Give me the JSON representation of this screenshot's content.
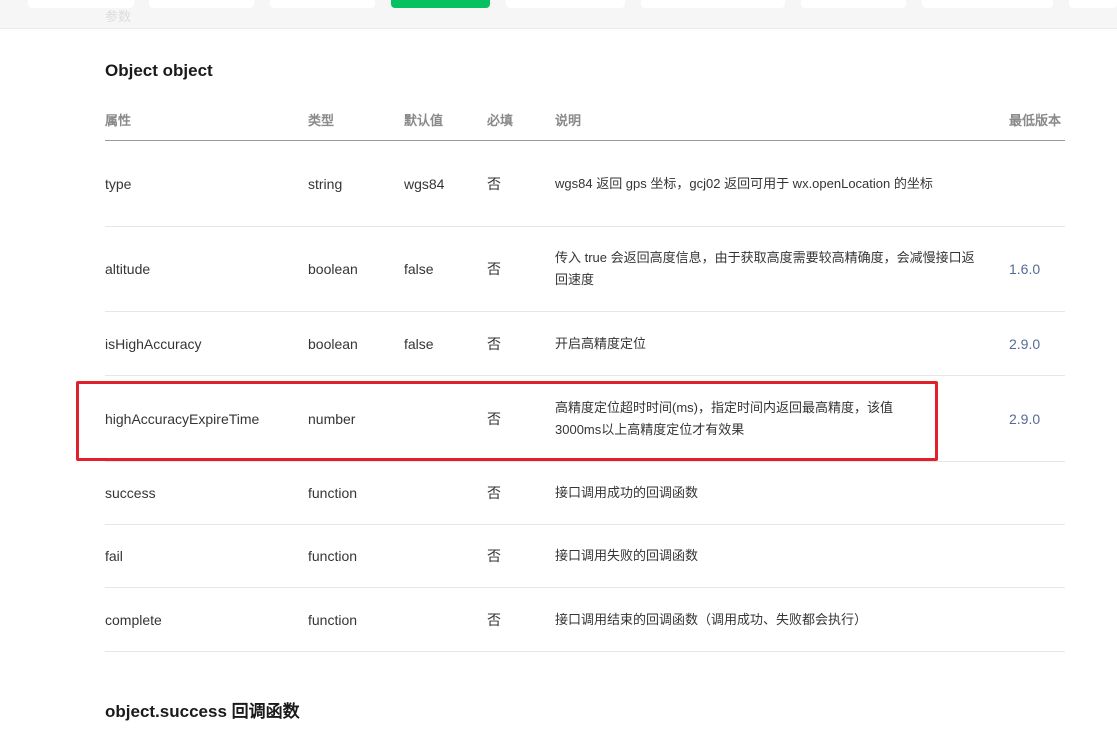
{
  "nav": {
    "faint_text": "参数",
    "tabs": [
      "",
      "",
      "",
      "",
      "",
      "",
      "",
      "",
      ""
    ],
    "active_color": "#07c160"
  },
  "section1": {
    "title": "Object object"
  },
  "table": {
    "headers": {
      "name": "属性",
      "type": "类型",
      "default": "默认值",
      "required": "必填",
      "desc": "说明",
      "version": "最低版本"
    },
    "rows": [
      {
        "name": "type",
        "type": "string",
        "default": "wgs84",
        "required": "否",
        "desc": "wgs84 返回 gps 坐标，gcj02 返回可用于 wx.openLocation 的坐标",
        "version": ""
      },
      {
        "name": "altitude",
        "type": "boolean",
        "default": "false",
        "required": "否",
        "desc": "传入 true 会返回高度信息，由于获取高度需要较高精确度，会减慢接口返回速度",
        "version": "1.6.0"
      },
      {
        "name": "isHighAccuracy",
        "type": "boolean",
        "default": "false",
        "required": "否",
        "desc": "开启高精度定位",
        "version": "2.9.0"
      },
      {
        "name": "highAccuracyExpireTime",
        "type": "number",
        "default": "",
        "required": "否",
        "desc": "高精度定位超时时间(ms)，指定时间内返回最高精度，该值3000ms以上高精度定位才有效果",
        "version": "2.9.0"
      },
      {
        "name": "success",
        "type": "function",
        "default": "",
        "required": "否",
        "desc": "接口调用成功的回调函数",
        "version": ""
      },
      {
        "name": "fail",
        "type": "function",
        "default": "",
        "required": "否",
        "desc": "接口调用失败的回调函数",
        "version": ""
      },
      {
        "name": "complete",
        "type": "function",
        "default": "",
        "required": "否",
        "desc": "接口调用结束的回调函数（调用成功、失败都会执行）",
        "version": ""
      }
    ]
  },
  "section2": {
    "title": "object.success 回调函数"
  },
  "colors": {
    "highlight": "#e0202a",
    "version_link": "#576b95"
  }
}
